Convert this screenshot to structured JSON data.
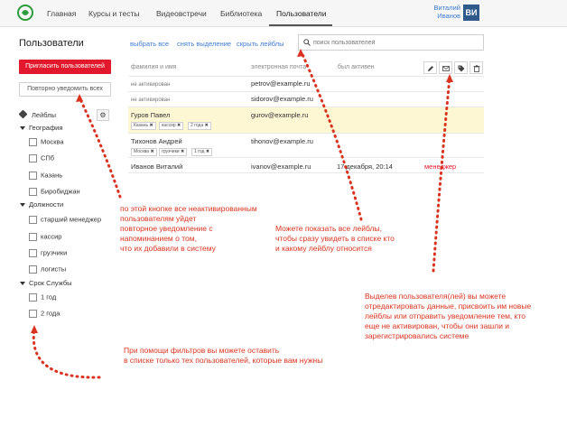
{
  "colors": {
    "accent": "#e2182c",
    "link": "#3d7bd3",
    "annotation": "#d9331f",
    "highlight": "#fdf7d4"
  },
  "nav": {
    "items": [
      "Главная",
      "Курсы и тесты",
      "Видеовстречи",
      "Библиотека",
      "Пользователи"
    ],
    "active": "Пользователи",
    "user_first": "Виталий",
    "user_last": "Иванов",
    "avatar": "ВИ"
  },
  "left": {
    "title": "Пользователи",
    "invite_label": "Пригласить пользователей",
    "notify_label": "Повторно уведомить всех",
    "labels_heading": "Лейблы",
    "groups": [
      {
        "name": "География",
        "items": [
          "Москва",
          "СПб",
          "Казань",
          "Биробиджан"
        ]
      },
      {
        "name": "Должности",
        "items": [
          "старший менеджер",
          "кассир",
          "грузчики",
          "логисты"
        ]
      },
      {
        "name": "Срок Службы",
        "items": [
          "1 год",
          "2 года"
        ]
      }
    ]
  },
  "toolbar": {
    "select_all": "выбрать все",
    "deselect": "снять выделение",
    "hide_labels": "скрыть лейблы",
    "search_placeholder": "поиск пользователей"
  },
  "table": {
    "headers": [
      "фамилия и имя",
      "электронная почта",
      "был активен"
    ],
    "rows": [
      {
        "name": "не активирован",
        "email": "petrov@example.ru",
        "active": "",
        "role": "",
        "labels": []
      },
      {
        "name": "не активирован",
        "email": "sidorov@example.ru",
        "active": "",
        "role": "",
        "labels": []
      },
      {
        "name": "Гуров Павел",
        "email": "gurov@example.ru",
        "active": "",
        "role": "",
        "labels": [
          "Казань ✖",
          "кассир ✖",
          "2 года ✖"
        ]
      },
      {
        "name": "Тихонов Андрей",
        "email": "tihonov@example.ru",
        "active": "",
        "role": "",
        "labels": [
          "Москва ✖",
          "грузчики ✖",
          "1 год ✖"
        ]
      },
      {
        "name": "Иванов Виталий",
        "email": "ivanov@example.ru",
        "active": "17 декабря, 20:14",
        "role": "менеджер",
        "labels": []
      }
    ]
  },
  "annotations": {
    "notify": "по этой кнопке все неактивированным\nпользователям уйдет\nповторное уведомление с\nнапоминанием о том,\nчто их добавили в систему",
    "labels": "Можете показать все лейблы,\nчтобы сразу увидеть в списке кто\nи какому лейблу относится",
    "edit": "Выделев пользователя(лей) вы можете\nотредактировать данные, присвоить им новые\nлейблы или отправить уведомление тем, кто\nеще не активирован, чтобы они зашли и\nзарегистрировались системе",
    "filters": "При помощи фильтров вы можете оставить\nв списке только тех пользователей, которые вам нужны"
  }
}
